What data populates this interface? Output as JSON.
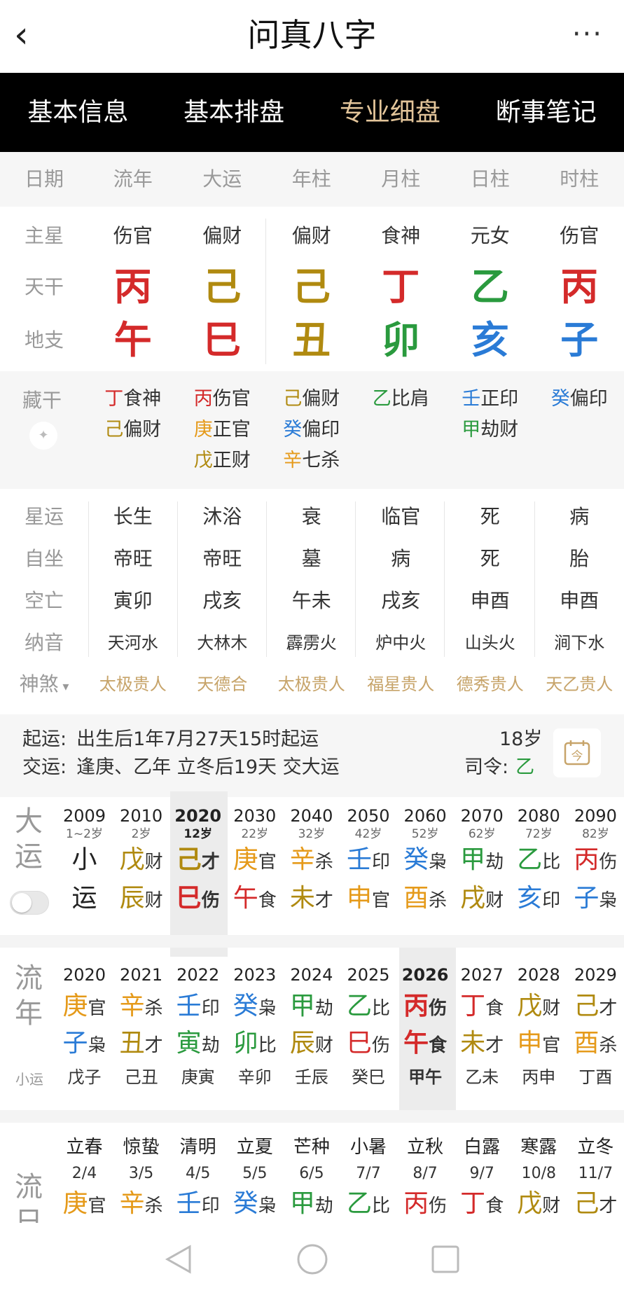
{
  "header": {
    "back_icon": "‹",
    "title": "问真八字",
    "more_icon": "···"
  },
  "tabs": [
    "基本信息",
    "基本排盘",
    "专业细盘",
    "断事笔记"
  ],
  "columns": {
    "row_label": "日期",
    "items": [
      "流年",
      "大运",
      "年柱",
      "月柱",
      "日柱",
      "时柱"
    ]
  },
  "main_star": {
    "label": "主星",
    "values": [
      "伤官",
      "偏财",
      "偏财",
      "食神",
      "元女",
      "伤官"
    ]
  },
  "tiangan": {
    "label": "天干",
    "values": [
      {
        "t": "丙",
        "c": "red"
      },
      {
        "t": "己",
        "c": "ol"
      },
      {
        "t": "己",
        "c": "ol"
      },
      {
        "t": "丁",
        "c": "red"
      },
      {
        "t": "乙",
        "c": "gr"
      },
      {
        "t": "丙",
        "c": "red"
      }
    ]
  },
  "dizhi": {
    "label": "地支",
    "values": [
      {
        "t": "午",
        "c": "red"
      },
      {
        "t": "巳",
        "c": "red"
      },
      {
        "t": "丑",
        "c": "ol"
      },
      {
        "t": "卯",
        "c": "gr"
      },
      {
        "t": "亥",
        "c": "bl"
      },
      {
        "t": "子",
        "c": "bl"
      }
    ]
  },
  "canggan": {
    "label": "藏干",
    "columns": [
      [
        {
          "g": "丁",
          "c": "red",
          "s": "食神"
        },
        {
          "g": "己",
          "c": "ol",
          "s": "偏财"
        }
      ],
      [
        {
          "g": "丙",
          "c": "red",
          "s": "伤官"
        },
        {
          "g": "庚",
          "c": "og",
          "s": "正官"
        },
        {
          "g": "戊",
          "c": "ol",
          "s": "正财"
        }
      ],
      [
        {
          "g": "己",
          "c": "ol",
          "s": "偏财"
        },
        {
          "g": "癸",
          "c": "bl",
          "s": "偏印"
        },
        {
          "g": "辛",
          "c": "og",
          "s": "七杀"
        }
      ],
      [
        {
          "g": "乙",
          "c": "gr",
          "s": "比肩"
        }
      ],
      [
        {
          "g": "壬",
          "c": "bl",
          "s": "正印"
        },
        {
          "g": "甲",
          "c": "gr",
          "s": "劫财"
        }
      ],
      [
        {
          "g": "癸",
          "c": "bl",
          "s": "偏印"
        }
      ]
    ]
  },
  "info_rows": [
    {
      "label": "星运",
      "values": [
        "长生",
        "沐浴",
        "衰",
        "临官",
        "死",
        "病"
      ]
    },
    {
      "label": "自坐",
      "values": [
        "帝旺",
        "帝旺",
        "墓",
        "病",
        "死",
        "胎"
      ]
    },
    {
      "label": "空亡",
      "values": [
        "寅卯",
        "戌亥",
        "午未",
        "戌亥",
        "申酉",
        "申酉"
      ]
    },
    {
      "label": "纳音",
      "values": [
        "天河水",
        "大林木",
        "霹雳火",
        "炉中火",
        "山头火",
        "涧下水"
      ]
    }
  ],
  "shensha": {
    "label": "神煞",
    "values": [
      "太极贵人",
      "天德合",
      "太极贵人",
      "福星贵人",
      "德秀贵人",
      "天乙贵人"
    ]
  },
  "qiyun": {
    "label": "起运:",
    "text": "出生后1年7月27天15时起运",
    "age": "18岁"
  },
  "jiaoyun": {
    "label": "交运:",
    "text": "逢庚、乙年 立冬后19天 交大运",
    "siling_label": "司令:",
    "siling": "乙"
  },
  "dayun": {
    "label": [
      "大",
      "运"
    ],
    "items": [
      {
        "y": "2009",
        "a": "1~2岁",
        "g": "小",
        "gc": "",
        "gs": "",
        "z": "运",
        "zc": "",
        "zs": ""
      },
      {
        "y": "2010",
        "a": "2岁",
        "g": "戊",
        "gc": "ol",
        "gs": "财",
        "z": "辰",
        "zc": "ol",
        "zs": "财"
      },
      {
        "y": "2020",
        "a": "12岁",
        "g": "己",
        "gc": "ol",
        "gs": "才",
        "z": "巳",
        "zc": "red",
        "zs": "伤"
      },
      {
        "y": "2030",
        "a": "22岁",
        "g": "庚",
        "gc": "og",
        "gs": "官",
        "z": "午",
        "zc": "red",
        "zs": "食"
      },
      {
        "y": "2040",
        "a": "32岁",
        "g": "辛",
        "gc": "og",
        "gs": "杀",
        "z": "未",
        "zc": "ol",
        "zs": "才"
      },
      {
        "y": "2050",
        "a": "42岁",
        "g": "壬",
        "gc": "bl",
        "gs": "印",
        "z": "申",
        "zc": "og",
        "zs": "官"
      },
      {
        "y": "2060",
        "a": "52岁",
        "g": "癸",
        "gc": "bl",
        "gs": "枭",
        "z": "酉",
        "zc": "og",
        "zs": "杀"
      },
      {
        "y": "2070",
        "a": "62岁",
        "g": "甲",
        "gc": "gr",
        "gs": "劫",
        "z": "戌",
        "zc": "ol",
        "zs": "财"
      },
      {
        "y": "2080",
        "a": "72岁",
        "g": "乙",
        "gc": "gr",
        "gs": "比",
        "z": "亥",
        "zc": "bl",
        "zs": "印"
      },
      {
        "y": "2090",
        "a": "82岁",
        "g": "丙",
        "gc": "red",
        "gs": "伤",
        "z": "子",
        "zc": "bl",
        "zs": "枭"
      }
    ]
  },
  "liunian": {
    "label": [
      "流",
      "年"
    ],
    "sub": "小运",
    "items": [
      {
        "y": "2020",
        "g": "庚",
        "gc": "og",
        "gs": "官",
        "z": "子",
        "zc": "bl",
        "zs": "枭",
        "x": "戊子"
      },
      {
        "y": "2021",
        "g": "辛",
        "gc": "og",
        "gs": "杀",
        "z": "丑",
        "zc": "ol",
        "zs": "才",
        "x": "己丑"
      },
      {
        "y": "2022",
        "g": "壬",
        "gc": "bl",
        "gs": "印",
        "z": "寅",
        "zc": "gr",
        "zs": "劫",
        "x": "庚寅"
      },
      {
        "y": "2023",
        "g": "癸",
        "gc": "bl",
        "gs": "枭",
        "z": "卯",
        "zc": "gr",
        "zs": "比",
        "x": "辛卯"
      },
      {
        "y": "2024",
        "g": "甲",
        "gc": "gr",
        "gs": "劫",
        "z": "辰",
        "zc": "ol",
        "zs": "财",
        "x": "壬辰"
      },
      {
        "y": "2025",
        "g": "乙",
        "gc": "gr",
        "gs": "比",
        "z": "巳",
        "zc": "red",
        "zs": "伤",
        "x": "癸巳"
      },
      {
        "y": "2026",
        "g": "丙",
        "gc": "red",
        "gs": "伤",
        "z": "午",
        "zc": "red",
        "zs": "食",
        "x": "甲午"
      },
      {
        "y": "2027",
        "g": "丁",
        "gc": "red",
        "gs": "食",
        "z": "未",
        "zc": "ol",
        "zs": "才",
        "x": "乙未"
      },
      {
        "y": "2028",
        "g": "戊",
        "gc": "ol",
        "gs": "财",
        "z": "申",
        "zc": "og",
        "zs": "官",
        "x": "丙申"
      },
      {
        "y": "2029",
        "g": "己",
        "gc": "ol",
        "gs": "才",
        "z": "酉",
        "zc": "og",
        "zs": "杀",
        "x": "丁酉"
      }
    ]
  },
  "liuyue": {
    "label": [
      "流",
      "日"
    ],
    "items": [
      {
        "j": "立春",
        "d": "2/4",
        "g": "庚",
        "gc": "og",
        "gs": "官"
      },
      {
        "j": "惊蛰",
        "d": "3/5",
        "g": "辛",
        "gc": "og",
        "gs": "杀"
      },
      {
        "j": "清明",
        "d": "4/5",
        "g": "壬",
        "gc": "bl",
        "gs": "印"
      },
      {
        "j": "立夏",
        "d": "5/5",
        "g": "癸",
        "gc": "bl",
        "gs": "枭"
      },
      {
        "j": "芒种",
        "d": "6/5",
        "g": "甲",
        "gc": "gr",
        "gs": "劫"
      },
      {
        "j": "小暑",
        "d": "7/7",
        "g": "乙",
        "gc": "gr",
        "gs": "比"
      },
      {
        "j": "立秋",
        "d": "8/7",
        "g": "丙",
        "gc": "red",
        "gs": "伤"
      },
      {
        "j": "白露",
        "d": "9/7",
        "g": "丁",
        "gc": "red",
        "gs": "食"
      },
      {
        "j": "寒露",
        "d": "10/8",
        "g": "戊",
        "gc": "ol",
        "gs": "财"
      },
      {
        "j": "立冬",
        "d": "11/7",
        "g": "己",
        "gc": "ol",
        "gs": "才"
      }
    ]
  },
  "colors": {
    "red": "#d42a2a",
    "ol": "#b08a10",
    "gr": "#2a9a3e",
    "bl": "#2a7bd6",
    "og": "#e59a1a",
    "gold": "#c7a46a"
  },
  "icons": {
    "calendar": "calendar-icon",
    "pin": "pin-icon",
    "nav_back": "triangle-back-icon",
    "nav_home": "circle-home-icon",
    "nav_recent": "square-recent-icon"
  }
}
